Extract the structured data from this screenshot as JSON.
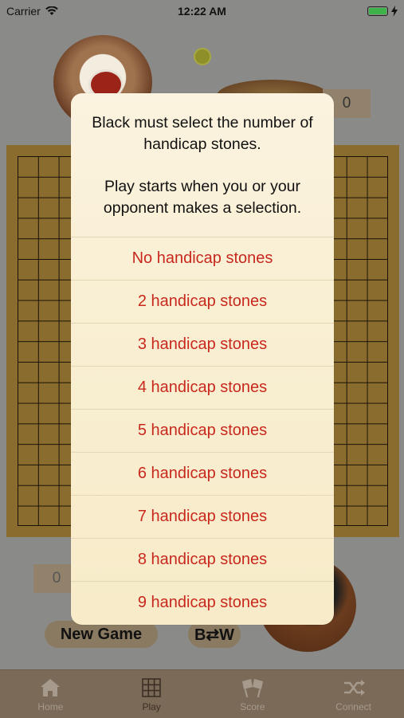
{
  "status": {
    "carrier": "Carrier",
    "time": "12:22 AM"
  },
  "scores": {
    "top": "0",
    "bottom": "0"
  },
  "controls": {
    "new_game": "New Game",
    "swap": "B⇄W"
  },
  "tabs": [
    {
      "label": "Home",
      "icon": "home-icon"
    },
    {
      "label": "Play",
      "icon": "grid-icon"
    },
    {
      "label": "Score",
      "icon": "checkered-flags-icon"
    },
    {
      "label": "Connect",
      "icon": "shuffle-icon"
    }
  ],
  "dialog": {
    "message_line1": "Black must select the number of handicap stones.",
    "message_line2": "Play starts when you or your opponent makes a selection.",
    "options": [
      "No handicap stones",
      "2 handicap stones",
      "3 handicap stones",
      "4 handicap stones",
      "5 handicap stones",
      "6 handicap stones",
      "7 handicap stones",
      "8 handicap stones",
      "9 handicap stones"
    ]
  },
  "colors": {
    "accent_red": "#c8281e",
    "tabbar": "#7c6a58",
    "battery": "#3db34a"
  }
}
